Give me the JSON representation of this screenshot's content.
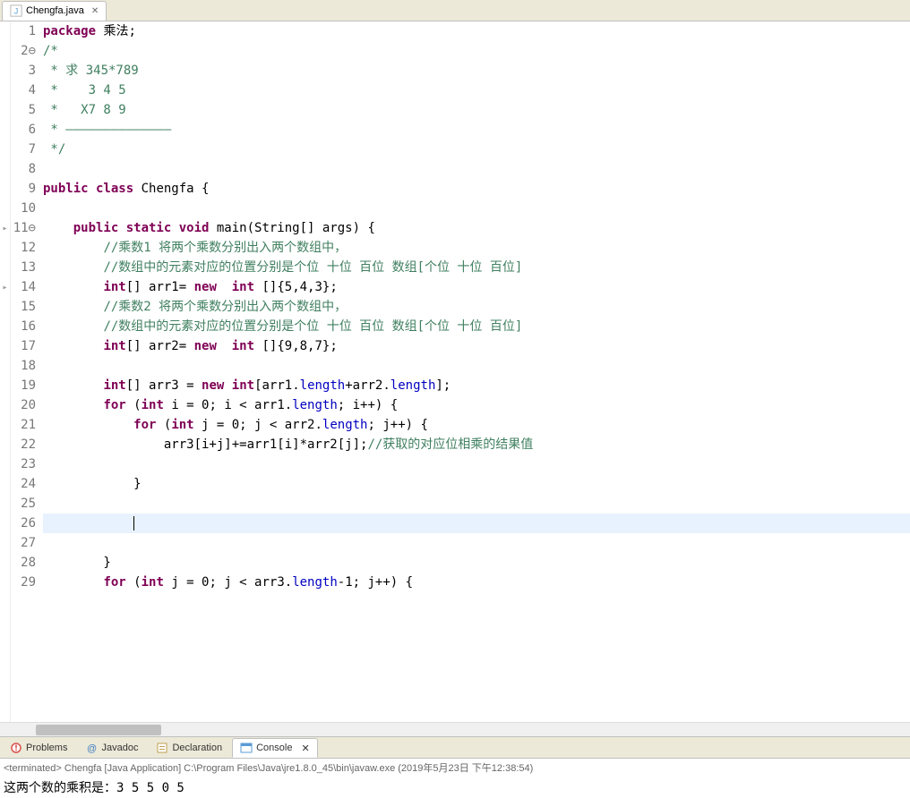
{
  "tab": {
    "filename": "Chengfa.java",
    "close_glyph": "✕"
  },
  "code": {
    "lines": [
      {
        "n": 1,
        "html": "<span class='kw'>package</span> 乘法;"
      },
      {
        "n": 2,
        "fold": "⊖",
        "html": "<span class='cm'>/*</span>"
      },
      {
        "n": 3,
        "html": "<span class='cm'> * 求 345*789</span>"
      },
      {
        "n": 4,
        "html": "<span class='cm'> *    3 4 5</span>"
      },
      {
        "n": 5,
        "html": "<span class='cm'> *   X7 8 9</span>"
      },
      {
        "n": 6,
        "html": "<span class='cm'> * ——————————————</span>"
      },
      {
        "n": 7,
        "html": "<span class='cm'> */</span>"
      },
      {
        "n": 8,
        "html": ""
      },
      {
        "n": 9,
        "html": "<span class='kw'>public class</span> Chengfa {"
      },
      {
        "n": 10,
        "html": ""
      },
      {
        "n": 11,
        "fold": "⊖",
        "marker": "▸",
        "html": "    <span class='kw'>public static void</span> main(String[] args) {"
      },
      {
        "n": 12,
        "html": "        <span class='cm'>//乘数1 将两个乘数分别出入两个数组中，</span>"
      },
      {
        "n": 13,
        "html": "        <span class='cm'>//数组中的元素对应的位置分别是个位 十位 百位 数组[个位 十位 百位]</span>"
      },
      {
        "n": 14,
        "marker": "▸",
        "html": "        <span class='kw'>int</span>[] arr1= <span class='kw'>new</span>  <span class='kw'>int</span> []{5,4,3};"
      },
      {
        "n": 15,
        "html": "        <span class='cm'>//乘数2 将两个乘数分别出入两个数组中，</span>"
      },
      {
        "n": 16,
        "html": "        <span class='cm'>//数组中的元素对应的位置分别是个位 十位 百位 数组[个位 十位 百位]</span>"
      },
      {
        "n": 17,
        "html": "        <span class='kw'>int</span>[] arr2= <span class='kw'>new</span>  <span class='kw'>int</span> []{9,8,7};"
      },
      {
        "n": 18,
        "html": ""
      },
      {
        "n": 19,
        "html": "        <span class='kw'>int</span>[] arr3 = <span class='kw'>new</span> <span class='kw'>int</span>[arr1.<span class='field'>length</span>+arr2.<span class='field'>length</span>];"
      },
      {
        "n": 20,
        "html": "        <span class='kw'>for</span> (<span class='kw'>int</span> i = 0; i &lt; arr1.<span class='field'>length</span>; i++) {"
      },
      {
        "n": 21,
        "html": "            <span class='kw'>for</span> (<span class='kw'>int</span> j = 0; j &lt; arr2.<span class='field'>length</span>; j++) {"
      },
      {
        "n": 22,
        "html": "                arr3[i+j]+=arr1[i]*arr2[j];<span class='cm'>//获取的对应位相乘的结果值</span>"
      },
      {
        "n": 23,
        "html": ""
      },
      {
        "n": 24,
        "html": "            }"
      },
      {
        "n": 25,
        "html": ""
      },
      {
        "n": 26,
        "current": true,
        "cursor": true,
        "html": "            "
      },
      {
        "n": 27,
        "html": ""
      },
      {
        "n": 28,
        "html": "        }"
      },
      {
        "n": 29,
        "html": "        <span class='kw'>for</span> (<span class='kw'>int</span> j = 0; j &lt; arr3.<span class='field'>length</span>-1; j++) {"
      }
    ]
  },
  "views": {
    "problems": "Problems",
    "javadoc": "Javadoc",
    "declaration": "Declaration",
    "console": "Console"
  },
  "console": {
    "header": "<terminated> Chengfa [Java Application] C:\\Program Files\\Java\\jre1.8.0_45\\bin\\javaw.exe (2019年5月23日 下午12:38:54)",
    "output": "这两个数的乘积是：3 5 5 0 5"
  }
}
